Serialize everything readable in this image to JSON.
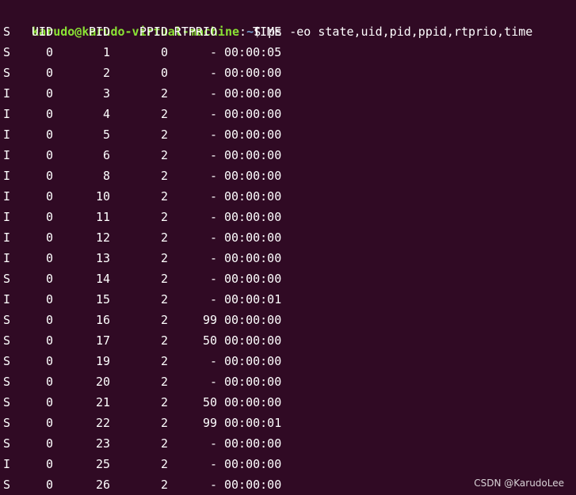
{
  "prompt": {
    "user_host": "karudo@karudo-virtual-machine",
    "colon": ":",
    "path": "~",
    "dollar": "$",
    "command": "ps -eo state,uid,pid,ppid,rtprio,time"
  },
  "headers": {
    "state": "S",
    "uid": "UID",
    "pid": "PID",
    "ppid": "PPID",
    "rtprio": "RTPRIO",
    "time": "TIME"
  },
  "rows": [
    {
      "state": "S",
      "uid": "0",
      "pid": "1",
      "ppid": "0",
      "rtprio": "-",
      "time": "00:00:05"
    },
    {
      "state": "S",
      "uid": "0",
      "pid": "2",
      "ppid": "0",
      "rtprio": "-",
      "time": "00:00:00"
    },
    {
      "state": "I",
      "uid": "0",
      "pid": "3",
      "ppid": "2",
      "rtprio": "-",
      "time": "00:00:00"
    },
    {
      "state": "I",
      "uid": "0",
      "pid": "4",
      "ppid": "2",
      "rtprio": "-",
      "time": "00:00:00"
    },
    {
      "state": "I",
      "uid": "0",
      "pid": "5",
      "ppid": "2",
      "rtprio": "-",
      "time": "00:00:00"
    },
    {
      "state": "I",
      "uid": "0",
      "pid": "6",
      "ppid": "2",
      "rtprio": "-",
      "time": "00:00:00"
    },
    {
      "state": "I",
      "uid": "0",
      "pid": "8",
      "ppid": "2",
      "rtprio": "-",
      "time": "00:00:00"
    },
    {
      "state": "I",
      "uid": "0",
      "pid": "10",
      "ppid": "2",
      "rtprio": "-",
      "time": "00:00:00"
    },
    {
      "state": "I",
      "uid": "0",
      "pid": "11",
      "ppid": "2",
      "rtprio": "-",
      "time": "00:00:00"
    },
    {
      "state": "I",
      "uid": "0",
      "pid": "12",
      "ppid": "2",
      "rtprio": "-",
      "time": "00:00:00"
    },
    {
      "state": "I",
      "uid": "0",
      "pid": "13",
      "ppid": "2",
      "rtprio": "-",
      "time": "00:00:00"
    },
    {
      "state": "S",
      "uid": "0",
      "pid": "14",
      "ppid": "2",
      "rtprio": "-",
      "time": "00:00:00"
    },
    {
      "state": "I",
      "uid": "0",
      "pid": "15",
      "ppid": "2",
      "rtprio": "-",
      "time": "00:00:01"
    },
    {
      "state": "S",
      "uid": "0",
      "pid": "16",
      "ppid": "2",
      "rtprio": "99",
      "time": "00:00:00"
    },
    {
      "state": "S",
      "uid": "0",
      "pid": "17",
      "ppid": "2",
      "rtprio": "50",
      "time": "00:00:00"
    },
    {
      "state": "S",
      "uid": "0",
      "pid": "19",
      "ppid": "2",
      "rtprio": "-",
      "time": "00:00:00"
    },
    {
      "state": "S",
      "uid": "0",
      "pid": "20",
      "ppid": "2",
      "rtprio": "-",
      "time": "00:00:00"
    },
    {
      "state": "S",
      "uid": "0",
      "pid": "21",
      "ppid": "2",
      "rtprio": "50",
      "time": "00:00:00"
    },
    {
      "state": "S",
      "uid": "0",
      "pid": "22",
      "ppid": "2",
      "rtprio": "99",
      "time": "00:00:01"
    },
    {
      "state": "S",
      "uid": "0",
      "pid": "23",
      "ppid": "2",
      "rtprio": "-",
      "time": "00:00:00"
    },
    {
      "state": "I",
      "uid": "0",
      "pid": "25",
      "ppid": "2",
      "rtprio": "-",
      "time": "00:00:00"
    },
    {
      "state": "S",
      "uid": "0",
      "pid": "26",
      "ppid": "2",
      "rtprio": "-",
      "time": "00:00:00"
    }
  ],
  "watermark": "CSDN @KarudoLee",
  "colors": {
    "background": "#300a24",
    "prompt_user": "#8ae234",
    "prompt_path": "#729fcf",
    "text": "#ffffff"
  }
}
